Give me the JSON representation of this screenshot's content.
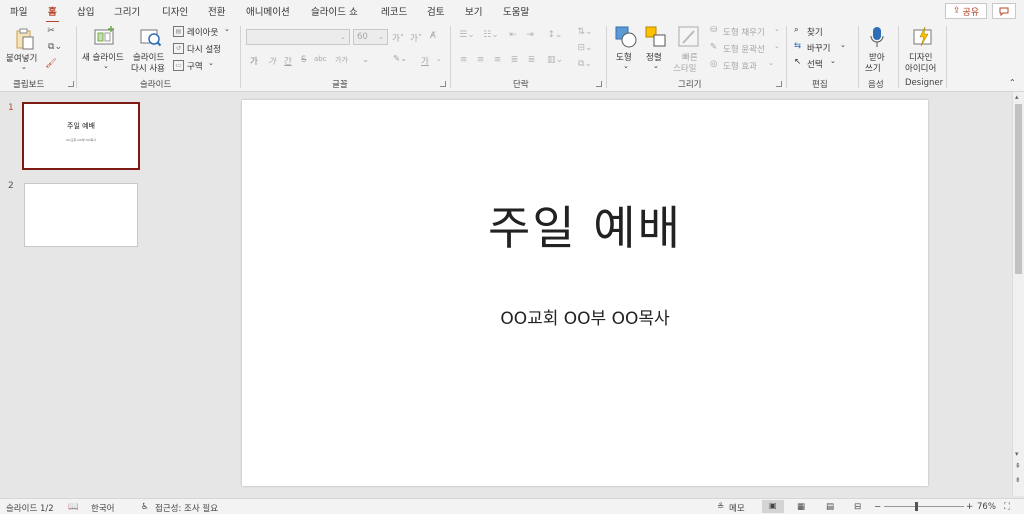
{
  "tabs": [
    "파일",
    "홈",
    "삽입",
    "그리기",
    "디자인",
    "전환",
    "애니메이션",
    "슬라이드 쇼",
    "레코드",
    "검토",
    "보기",
    "도움말"
  ],
  "active_tab": "홈",
  "share_label": "공유",
  "ribbon": {
    "clipboard": {
      "paste_label": "붙여넣기",
      "group_label": "클립보드"
    },
    "slides": {
      "new_slide_label": "새 슬라이드",
      "reuse_label_1": "슬라이드",
      "reuse_label_2": "다시 사용",
      "layout_label": "레이아웃",
      "reset_label": "다시 설정",
      "section_label": "구역",
      "group_label": "슬라이드"
    },
    "font": {
      "size_value": "60",
      "grow_label": "가˄",
      "shrink_label": "가˅",
      "bold": "가",
      "italic": "가",
      "underline": "간",
      "strike": "S",
      "spacing": "abc",
      "case": "가가",
      "highlight": "가",
      "group_label": "글꼴"
    },
    "paragraph": {
      "group_label": "단락"
    },
    "drawing": {
      "shapes_label": "도형",
      "arrange_label": "정렬",
      "quick_styles_label_1": "빠른",
      "quick_styles_label_2": "스타일",
      "fill_label": "도형 채우기",
      "outline_label": "도형 윤곽선",
      "effects_label": "도형 효과",
      "group_label": "그리기"
    },
    "editing": {
      "find_label": "찾기",
      "replace_label": "바꾸기",
      "select_label": "선택",
      "group_label": "편집"
    },
    "voice": {
      "dictate_label_1": "받아",
      "dictate_label_2": "쓰기",
      "group_label": "음성"
    },
    "designer": {
      "ideas_label_1": "디자인",
      "ideas_label_2": "아이디어",
      "group_label": "Designer"
    }
  },
  "thumbnails": [
    {
      "number": "1",
      "title": "주일 예배",
      "subtitle": "OO교회 OO부 OO목사"
    },
    {
      "number": "2"
    }
  ],
  "slide": {
    "title": "주일 예배",
    "subtitle": "OO교회 OO부 OO목사"
  },
  "status": {
    "slide_counter": "슬라이드 1/2",
    "language": "한국어",
    "accessibility": "접근성: 조사 필요",
    "notes_label": "메모",
    "zoom": "76%"
  },
  "colors": {
    "accent": "#b7472a",
    "thumb_selected_border": "#7d1a12"
  }
}
